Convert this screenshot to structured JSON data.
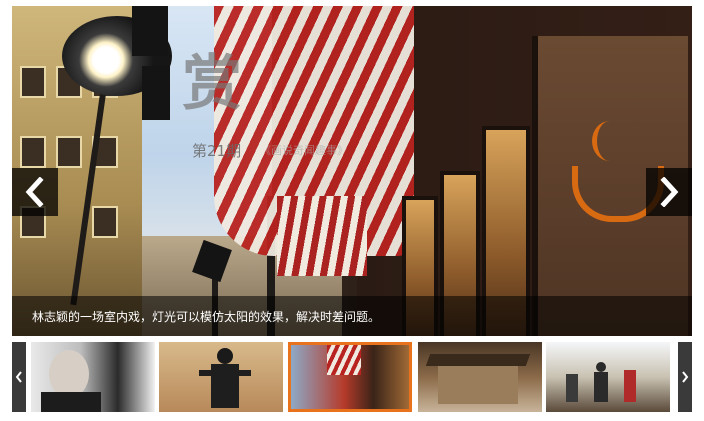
{
  "slideshow": {
    "watermark_title": "赏",
    "issue_label": "第21期",
    "issue_subtitle": "《画说奇闻趣事》",
    "caption": "林志颖的一场室内戏，灯光可以模仿太阳的效果，解决时差问题。",
    "prev_icon": "chevron-left-icon",
    "next_icon": "chevron-right-icon"
  },
  "thumbnails": {
    "count": 5,
    "active_index": 3,
    "accent_color": "#e8731c"
  }
}
